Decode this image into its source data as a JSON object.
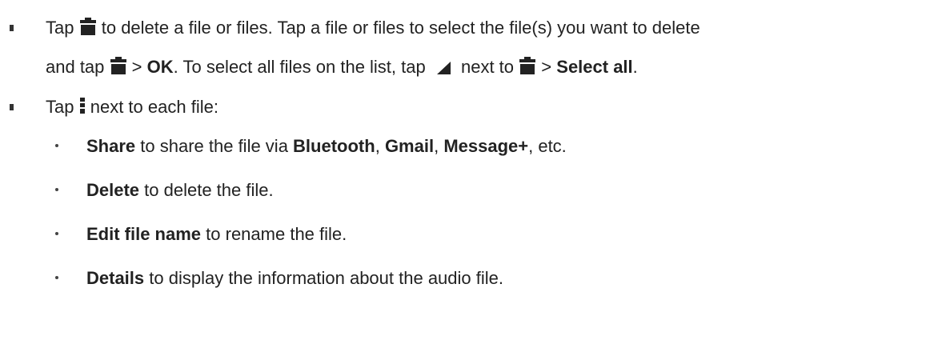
{
  "item1": {
    "line1": {
      "tap": "Tap",
      "rest": "to delete a file or files. Tap a file or files to select the file(s) you want to delete"
    },
    "line2": {
      "and_tap": "and tap",
      "gt1": ">",
      "ok": "OK",
      "mid": ". To select all files on the list, tap",
      "next_to": "next to",
      "gt2": ">",
      "select_all": "Select all",
      "period": "."
    }
  },
  "item2": {
    "tap": "Tap",
    "rest": "next to each file:"
  },
  "subitems": [
    {
      "bold": "Share",
      "parts": [
        " to share the file via ",
        "Bluetooth",
        ", ",
        "Gmail",
        ", ",
        "Message+",
        ", etc."
      ]
    },
    {
      "bold": "Delete",
      "rest": " to delete the file."
    },
    {
      "bold": "Edit file name",
      "rest": " to rename the file."
    },
    {
      "bold": "Details",
      "rest": " to display the information about the audio file."
    }
  ],
  "icons": {
    "trash": "trash-icon",
    "menu": "menu-dots-icon",
    "corner": "select-corner-icon"
  }
}
